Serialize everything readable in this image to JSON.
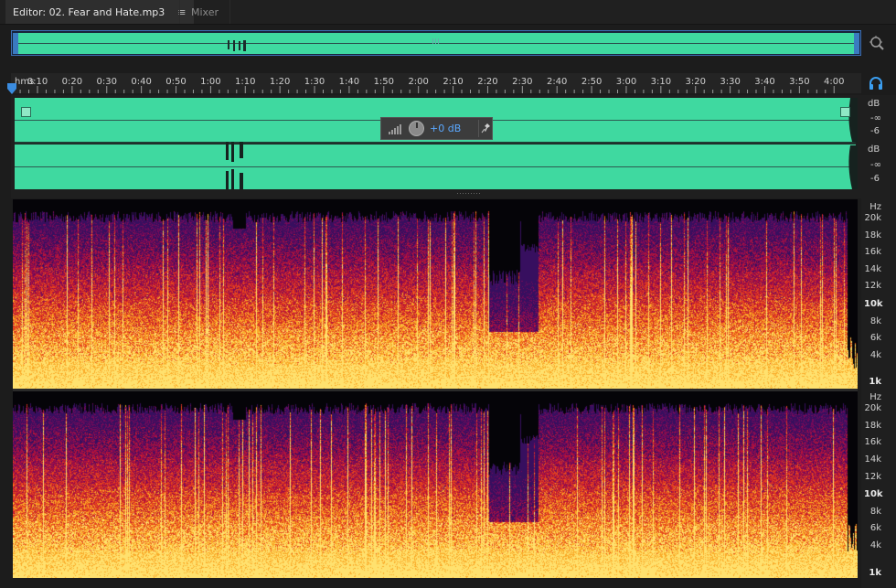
{
  "tabs": {
    "editor_label": "Editor: 02. Fear and Hate.mp3",
    "editor_menu": "≡",
    "mixer_label": "Mixer"
  },
  "ruler": {
    "unit": "hms",
    "ticks": [
      "0:10",
      "0:20",
      "0:30",
      "0:40",
      "0:50",
      "1:00",
      "1:10",
      "1:20",
      "1:30",
      "1:40",
      "1:50",
      "2:00",
      "2:10",
      "2:20",
      "2:30",
      "2:40",
      "2:50",
      "3:00",
      "3:10",
      "3:20",
      "3:30",
      "3:40",
      "3:50",
      "4:00"
    ]
  },
  "hud": {
    "gain_value": "+0 dB"
  },
  "amplitude_scale": {
    "ch1": [
      "dB",
      "-∞",
      "-6"
    ],
    "ch2": [
      "dB",
      "-∞",
      "-6"
    ]
  },
  "frequency_scale": {
    "ch1": [
      {
        "label": "Hz",
        "bold": false
      },
      {
        "label": "20k",
        "bold": false
      },
      {
        "label": "18k",
        "bold": false
      },
      {
        "label": "16k",
        "bold": false
      },
      {
        "label": "14k",
        "bold": false
      },
      {
        "label": "12k",
        "bold": false
      },
      {
        "label": "10k",
        "bold": true
      },
      {
        "label": "8k",
        "bold": false
      },
      {
        "label": "6k",
        "bold": false
      },
      {
        "label": "4k",
        "bold": false
      },
      {
        "label": "1k",
        "bold": true
      }
    ],
    "ch2": [
      {
        "label": "Hz",
        "bold": false
      },
      {
        "label": "20k",
        "bold": false
      },
      {
        "label": "18k",
        "bold": false
      },
      {
        "label": "16k",
        "bold": false
      },
      {
        "label": "14k",
        "bold": false
      },
      {
        "label": "12k",
        "bold": false
      },
      {
        "label": "10k",
        "bold": true
      },
      {
        "label": "8k",
        "bold": false
      },
      {
        "label": "6k",
        "bold": false
      },
      {
        "label": "4k",
        "bold": false
      },
      {
        "label": "1k",
        "bold": true
      }
    ]
  },
  "colors": {
    "waveform": "#3fd9a0",
    "accent": "#3b6fb5",
    "gain_text": "#5aa8ff"
  },
  "icons": {
    "editor_menu": "hamburger-icon",
    "zoom": "zoom-target-icon",
    "playhead": "playhead-marker-icon",
    "monitor": "headphones-icon",
    "fade_in": "fade-in-icon",
    "fade_out": "fade-out-icon",
    "gain": "level-bars-icon",
    "pin": "pin-icon"
  }
}
